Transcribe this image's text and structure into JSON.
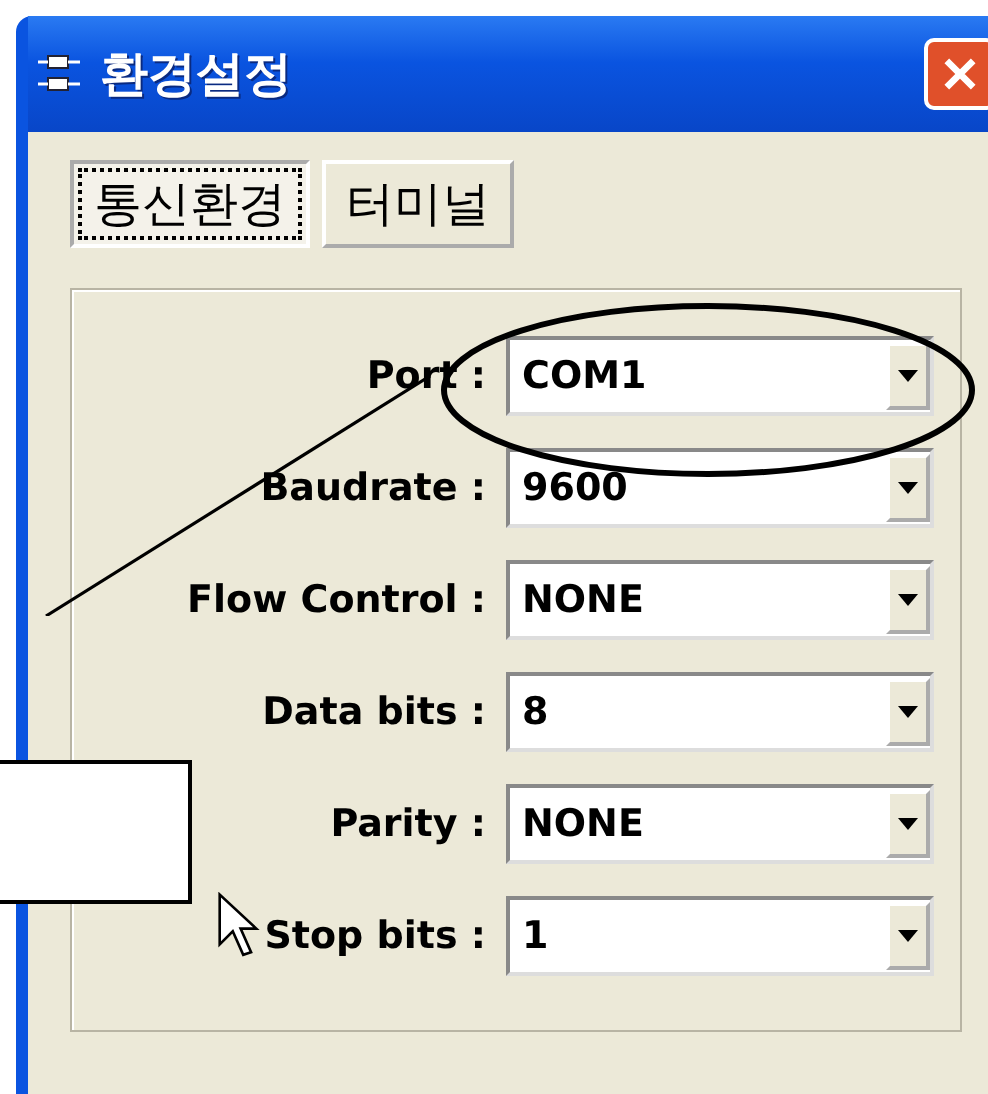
{
  "window": {
    "title": "환경설정"
  },
  "tabs": [
    {
      "label": "통신환경",
      "selected": true
    },
    {
      "label": "터미널",
      "selected": false
    }
  ],
  "fields": [
    {
      "label": "Port :",
      "value": "COM1"
    },
    {
      "label": "Baudrate :",
      "value": "9600"
    },
    {
      "label": "Flow Control :",
      "value": "NONE"
    },
    {
      "label": "Data bits :",
      "value": "8"
    },
    {
      "label": "Parity :",
      "value": "NONE"
    },
    {
      "label": "Stop bits :",
      "value": "1"
    }
  ]
}
